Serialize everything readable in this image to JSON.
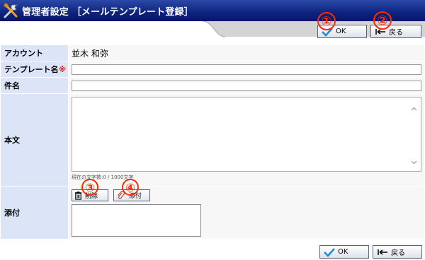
{
  "header": {
    "title": "管理者設定 ［メールテンプレート登録］",
    "icon": "tools-icon"
  },
  "toolbar": {
    "ok_label": "OK",
    "back_label": "戻る"
  },
  "annotations": [
    "①",
    "②",
    "③",
    "④"
  ],
  "form": {
    "account_label": "アカウント",
    "account_value": "並木 和弥",
    "template_name_label": "テンプレート名",
    "required_mark": "※",
    "subject_label": "件名",
    "body_label": "本文",
    "counter_text": "現在の文字数:0 / 1000文字",
    "attach_label": "添付",
    "delete_label": "削除",
    "attach_button_label": "添付"
  },
  "colors": {
    "titlebar": "#0d237e",
    "label_bg": "#dbe5f7",
    "annotation": "#ff2a00"
  }
}
